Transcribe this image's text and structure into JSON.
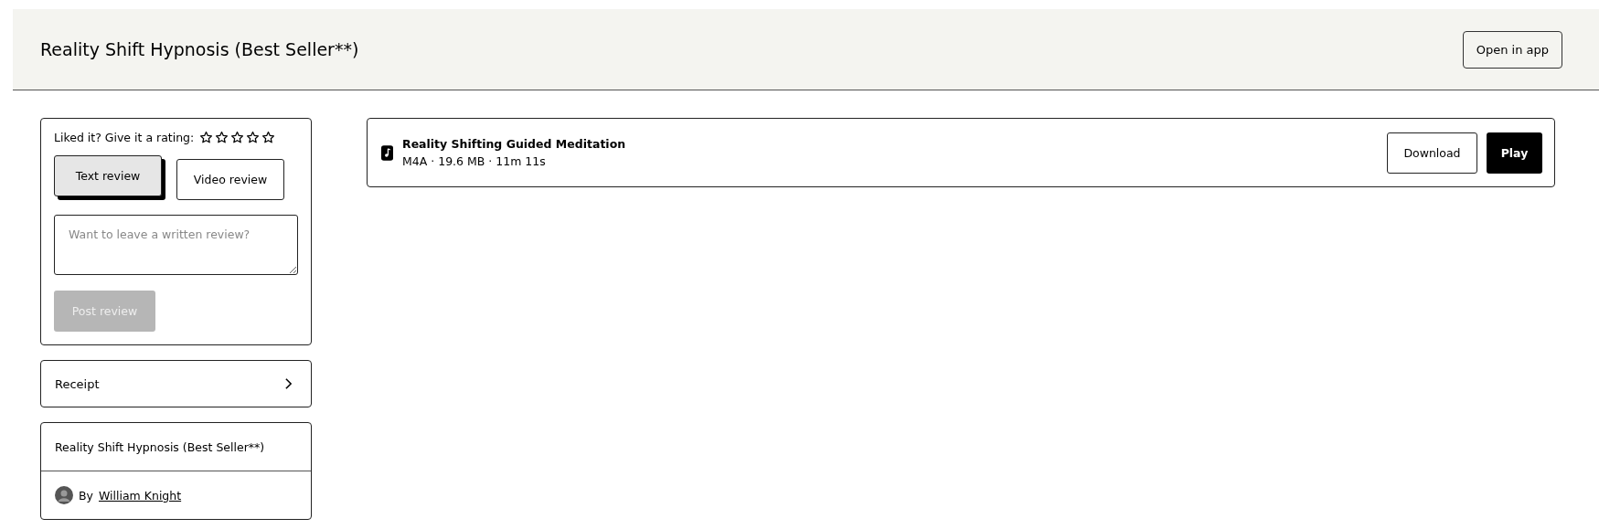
{
  "header": {
    "title": "Reality Shift Hypnosis (Best Seller**)",
    "open_button": "Open in app"
  },
  "rating": {
    "prompt": "Liked it? Give it a rating:",
    "stars": 0
  },
  "review_tabs": [
    {
      "label": "Text review",
      "selected": true
    },
    {
      "label": "Video review",
      "selected": false
    }
  ],
  "review_field": {
    "placeholder": "Want to leave a written review?"
  },
  "post_button": {
    "label": "Post review",
    "disabled": true
  },
  "receipt": {
    "label": "Receipt"
  },
  "product": {
    "title": "Reality Shift Hypnosis (Best Seller**)",
    "by": "By",
    "author": "William Knight"
  },
  "files": [
    {
      "name": "Reality Shifting Guided Meditation",
      "meta": "M4A · 19.6 MB · 11m 11s",
      "download": "Download",
      "play": "Play"
    }
  ]
}
